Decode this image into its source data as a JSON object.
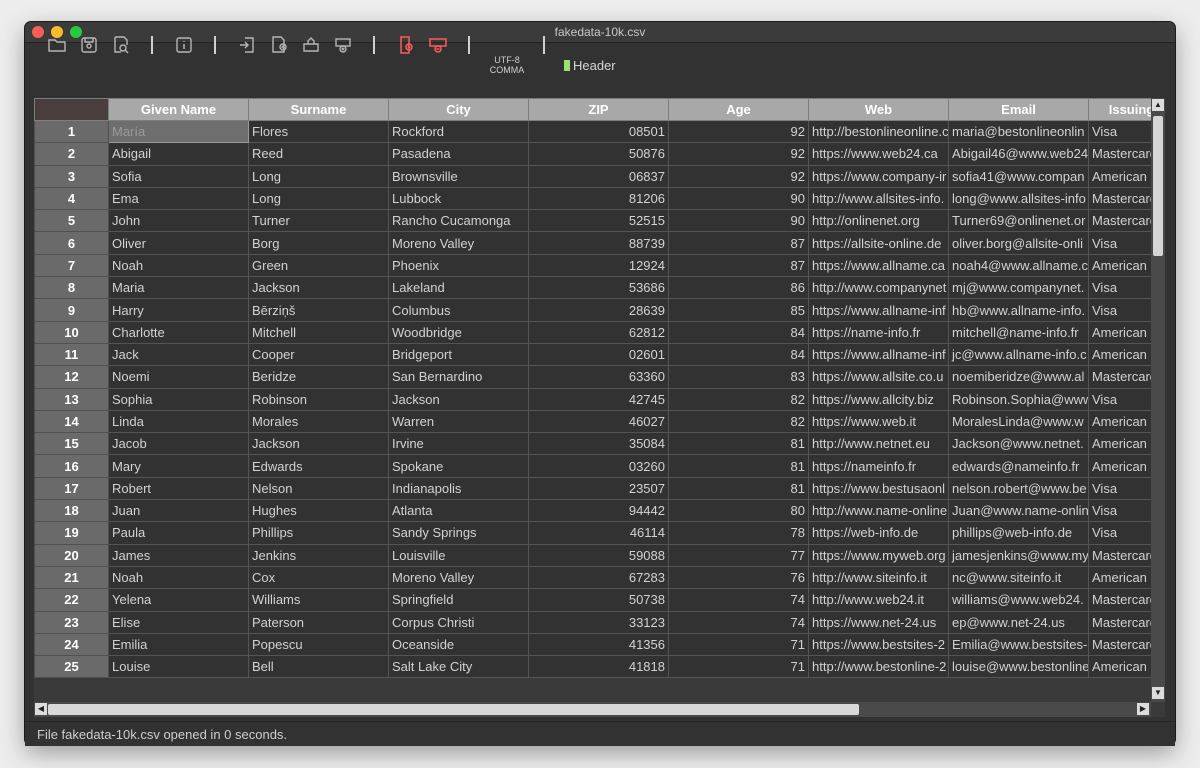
{
  "window": {
    "title": "fakedata-10k.csv"
  },
  "toolbar": {
    "encoding": "UTF-8",
    "delimiter": "COMMA",
    "header_label": "Header",
    "icons": [
      "folder-open-icon",
      "save-icon",
      "search-file-icon",
      "info-icon",
      "import-icon",
      "add-column-icon",
      "export-icon",
      "add-row-icon",
      "remove-column-icon",
      "remove-row-icon"
    ]
  },
  "table": {
    "columns": [
      "Given Name",
      "Surname",
      "City",
      "ZIP",
      "Age",
      "Web",
      "Email",
      "Issuing"
    ],
    "rows": [
      {
        "n": "1",
        "given": "María",
        "surname": "Flores",
        "city": "Rockford",
        "zip": "08501",
        "age": "92",
        "web": "http://bestonlineonline.c",
        "email": "maria@bestonlineonlin",
        "issuing": "Visa"
      },
      {
        "n": "2",
        "given": "Abigail",
        "surname": "Reed",
        "city": "Pasadena",
        "zip": "50876",
        "age": "92",
        "web": "https://www.web24.ca",
        "email": "Abigail46@www.web24",
        "issuing": "Mastercard"
      },
      {
        "n": "3",
        "given": "Sofia",
        "surname": "Long",
        "city": "Brownsville",
        "zip": "06837",
        "age": "92",
        "web": "https://www.company-ir",
        "email": "sofia41@www.compan",
        "issuing": "American E"
      },
      {
        "n": "4",
        "given": "Ema",
        "surname": "Long",
        "city": "Lubbock",
        "zip": "81206",
        "age": "90",
        "web": "http://www.allsites-info.",
        "email": "long@www.allsites-info",
        "issuing": "Mastercard"
      },
      {
        "n": "5",
        "given": "John",
        "surname": "Turner",
        "city": "Rancho Cucamonga",
        "zip": "52515",
        "age": "90",
        "web": "http://onlinenet.org",
        "email": "Turner69@onlinenet.or",
        "issuing": "Mastercard"
      },
      {
        "n": "6",
        "given": "Oliver",
        "surname": "Borg",
        "city": "Moreno Valley",
        "zip": "88739",
        "age": "87",
        "web": "https://allsite-online.de",
        "email": "oliver.borg@allsite-onli",
        "issuing": "Visa"
      },
      {
        "n": "7",
        "given": "Noah",
        "surname": "Green",
        "city": "Phoenix",
        "zip": "12924",
        "age": "87",
        "web": "https://www.allname.ca",
        "email": "noah4@www.allname.c",
        "issuing": "American E"
      },
      {
        "n": "8",
        "given": "Maria",
        "surname": "Jackson",
        "city": "Lakeland",
        "zip": "53686",
        "age": "86",
        "web": "http://www.companynet",
        "email": "mj@www.companynet.",
        "issuing": "Visa"
      },
      {
        "n": "9",
        "given": "Harry",
        "surname": "Bērziņš",
        "city": "Columbus",
        "zip": "28639",
        "age": "85",
        "web": "https://www.allname-inf",
        "email": "hb@www.allname-info.",
        "issuing": "Visa"
      },
      {
        "n": "10",
        "given": "Charlotte",
        "surname": "Mitchell",
        "city": "Woodbridge",
        "zip": "62812",
        "age": "84",
        "web": "https://name-info.fr",
        "email": "mitchell@name-info.fr",
        "issuing": "American E"
      },
      {
        "n": "11",
        "given": "Jack",
        "surname": "Cooper",
        "city": "Bridgeport",
        "zip": "02601",
        "age": "84",
        "web": "https://www.allname-inf",
        "email": "jc@www.allname-info.c",
        "issuing": "American E"
      },
      {
        "n": "12",
        "given": "Noemi",
        "surname": "Beridze",
        "city": "San Bernardino",
        "zip": "63360",
        "age": "83",
        "web": "https://www.allsite.co.u",
        "email": "noemiberidze@www.al",
        "issuing": "Mastercard"
      },
      {
        "n": "13",
        "given": "Sophia",
        "surname": "Robinson",
        "city": "Jackson",
        "zip": "42745",
        "age": "82",
        "web": "https://www.allcity.biz",
        "email": "Robinson.Sophia@www",
        "issuing": "Visa"
      },
      {
        "n": "14",
        "given": "Linda",
        "surname": "Morales",
        "city": "Warren",
        "zip": "46027",
        "age": "82",
        "web": "https://www.web.it",
        "email": "MoralesLinda@www.w",
        "issuing": "American E"
      },
      {
        "n": "15",
        "given": "Jacob",
        "surname": "Jackson",
        "city": "Irvine",
        "zip": "35084",
        "age": "81",
        "web": "http://www.netnet.eu",
        "email": "Jackson@www.netnet.",
        "issuing": "American E"
      },
      {
        "n": "16",
        "given": "Mary",
        "surname": "Edwards",
        "city": "Spokane",
        "zip": "03260",
        "age": "81",
        "web": "https://nameinfo.fr",
        "email": "edwards@nameinfo.fr",
        "issuing": "American E"
      },
      {
        "n": "17",
        "given": "Robert",
        "surname": "Nelson",
        "city": "Indianapolis",
        "zip": "23507",
        "age": "81",
        "web": "https://www.bestusaonl",
        "email": "nelson.robert@www.be",
        "issuing": "Visa"
      },
      {
        "n": "18",
        "given": "Juan",
        "surname": "Hughes",
        "city": "Atlanta",
        "zip": "94442",
        "age": "80",
        "web": "http://www.name-online",
        "email": "Juan@www.name-onlin",
        "issuing": "Visa"
      },
      {
        "n": "19",
        "given": "Paula",
        "surname": "Phillips",
        "city": "Sandy Springs",
        "zip": "46114",
        "age": "78",
        "web": "https://web-info.de",
        "email": "phillips@web-info.de",
        "issuing": "Visa"
      },
      {
        "n": "20",
        "given": "James",
        "surname": "Jenkins",
        "city": "Louisville",
        "zip": "59088",
        "age": "77",
        "web": "https://www.myweb.org",
        "email": "jamesjenkins@www.my",
        "issuing": "Mastercard"
      },
      {
        "n": "21",
        "given": "Noah",
        "surname": "Cox",
        "city": "Moreno Valley",
        "zip": "67283",
        "age": "76",
        "web": "http://www.siteinfo.it",
        "email": "nc@www.siteinfo.it",
        "issuing": "American E"
      },
      {
        "n": "22",
        "given": "Yelena",
        "surname": "Williams",
        "city": "Springfield",
        "zip": "50738",
        "age": "74",
        "web": "http://www.web24.it",
        "email": "williams@www.web24.",
        "issuing": "Mastercard"
      },
      {
        "n": "23",
        "given": "Elise",
        "surname": "Paterson",
        "city": "Corpus Christi",
        "zip": "33123",
        "age": "74",
        "web": "https://www.net-24.us",
        "email": "ep@www.net-24.us",
        "issuing": "Mastercard"
      },
      {
        "n": "24",
        "given": "Emilia",
        "surname": "Popescu",
        "city": "Oceanside",
        "zip": "41356",
        "age": "71",
        "web": "https://www.bestsites-2",
        "email": "Emilia@www.bestsites-",
        "issuing": "Mastercard"
      },
      {
        "n": "25",
        "given": "Louise",
        "surname": "Bell",
        "city": "Salt Lake City",
        "zip": "41818",
        "age": "71",
        "web": "http://www.bestonline-2",
        "email": "louise@www.bestonline",
        "issuing": "American E"
      }
    ]
  },
  "status": {
    "text": "File fakedata-10k.csv opened in 0 seconds."
  },
  "colors": {
    "header_bg": "#a8a8a8",
    "row_header_bg": "#6a6a6a",
    "cell_bg": "#323232",
    "remove_icon": "#ff5a5a"
  }
}
